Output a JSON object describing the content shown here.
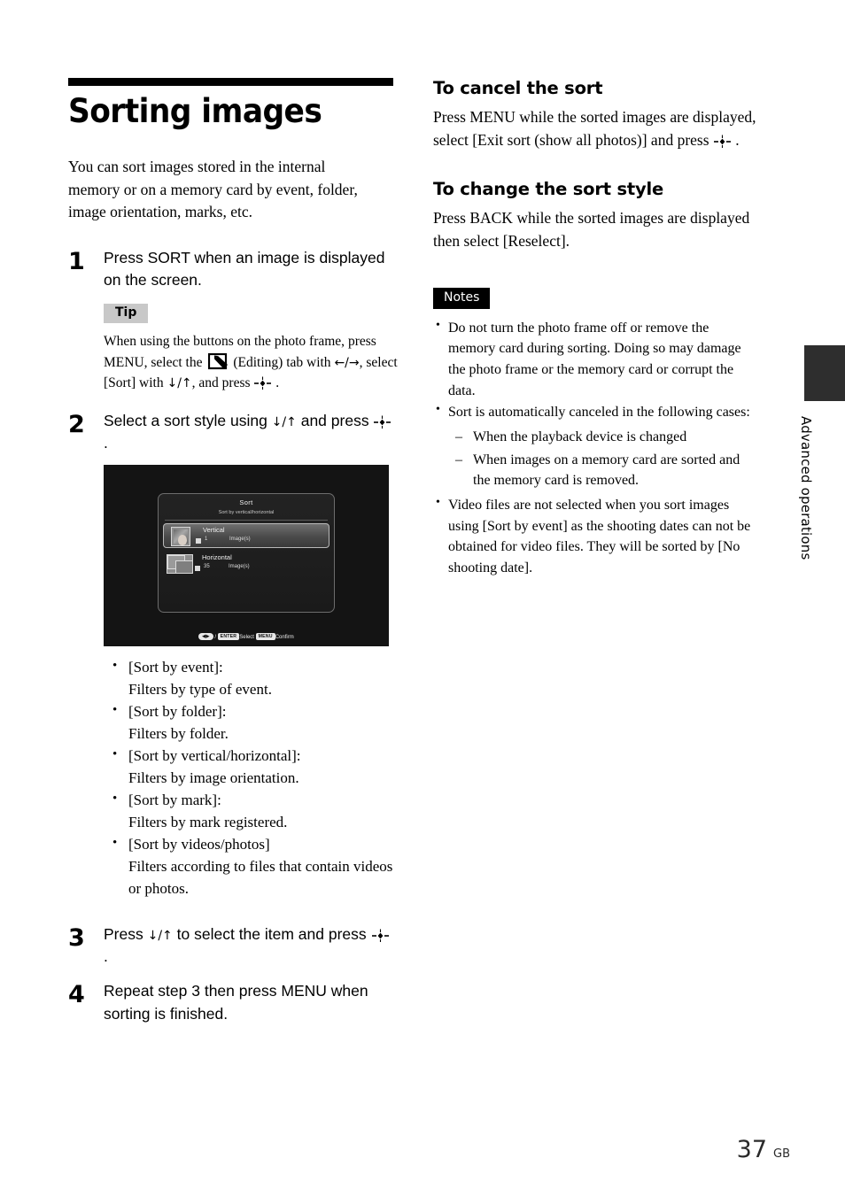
{
  "document": {
    "title": "Sorting images",
    "intro": "You can sort images stored in the internal memory or on a memory card by event, folder, image orientation, marks, etc."
  },
  "steps": [
    {
      "num": "1",
      "text": "Press SORT when an image is displayed on the screen."
    },
    {
      "num": "2",
      "text_before": "Select a sort style using ",
      "arrows": "↓/↑",
      "text_middle": " and press ",
      "text_after": " ."
    },
    {
      "num": "3",
      "text_before": "Press ",
      "arrows": "↓/↑",
      "text_middle": " to select the item and press ",
      "text_after": " ."
    },
    {
      "num": "4",
      "text": "Repeat step 3 then press MENU when sorting is finished."
    }
  ],
  "tip": {
    "label": "Tip",
    "line1": "When using the buttons on the photo frame,",
    "line2_a": "press MENU, select the ",
    "icon_name": "editing-tab-icon",
    "line2_b": "(Editing) tab with",
    "line3_arrows_lr": "←/→",
    "line3_a": ", select [Sort] with ",
    "line3_arrows_ud": "↓/↑",
    "line3_b": ", and press ",
    "line3_c": " ."
  },
  "device_screen": {
    "title": "Sort",
    "subtitle": "Sort by vertical/horizontal",
    "rows": [
      {
        "name": "Vertical",
        "count": "1",
        "unit": "Image(s)",
        "selected": true
      },
      {
        "name": "Horizontal",
        "count": "35",
        "unit": "Image(s)",
        "selected": false
      }
    ],
    "bottom_bar": {
      "dpad_key": "◀▶",
      "separator": "/",
      "enter_key": "ENTER",
      "enter_action": "Select",
      "menu_key": "MENU",
      "menu_action": "Confirm"
    }
  },
  "sort_styles": [
    {
      "term": "[Sort by event]:",
      "desc": "Filters by type of event."
    },
    {
      "term": "[Sort by folder]:",
      "desc": "Filters by folder."
    },
    {
      "term": "[Sort by vertical/horizontal]:",
      "desc": "Filters by image orientation."
    },
    {
      "term": "[Sort by mark]:",
      "desc": "Filters by mark registered."
    },
    {
      "term": "[Sort by videos/photos]",
      "desc": "Filters according to files that contain videos or photos."
    }
  ],
  "sections": [
    {
      "heading": "To cancel the sort",
      "body_a": "Press MENU while the sorted images are displayed, select [Exit sort (show all photos)] and press ",
      "body_b": " ."
    },
    {
      "heading": "To change the sort style",
      "body": "Press BACK while the sorted images are displayed then select [Reselect]."
    }
  ],
  "notes": {
    "label": "Notes",
    "items": [
      "Do not turn the photo frame off or remove the memory card during sorting. Doing so may damage the photo frame or the memory card or corrupt the data.",
      "Sort is automatically canceled in the following cases:",
      "Video files are not selected when you sort images using [Sort by event] as the shooting dates can not be obtained for video files. They will be sorted by [No shooting date]."
    ],
    "sub_items": [
      "When the playback device is changed",
      "When images on a memory card are sorted and the memory card is removed."
    ]
  },
  "side_tab": {
    "label": "Advanced operations"
  },
  "footer": {
    "page_number": "37",
    "suffix": "GB"
  },
  "colors": {
    "tip_background": "#c8c8c8",
    "notes_background": "#000000",
    "side_tab": "#2e2e2e",
    "device_background": "#141414"
  }
}
